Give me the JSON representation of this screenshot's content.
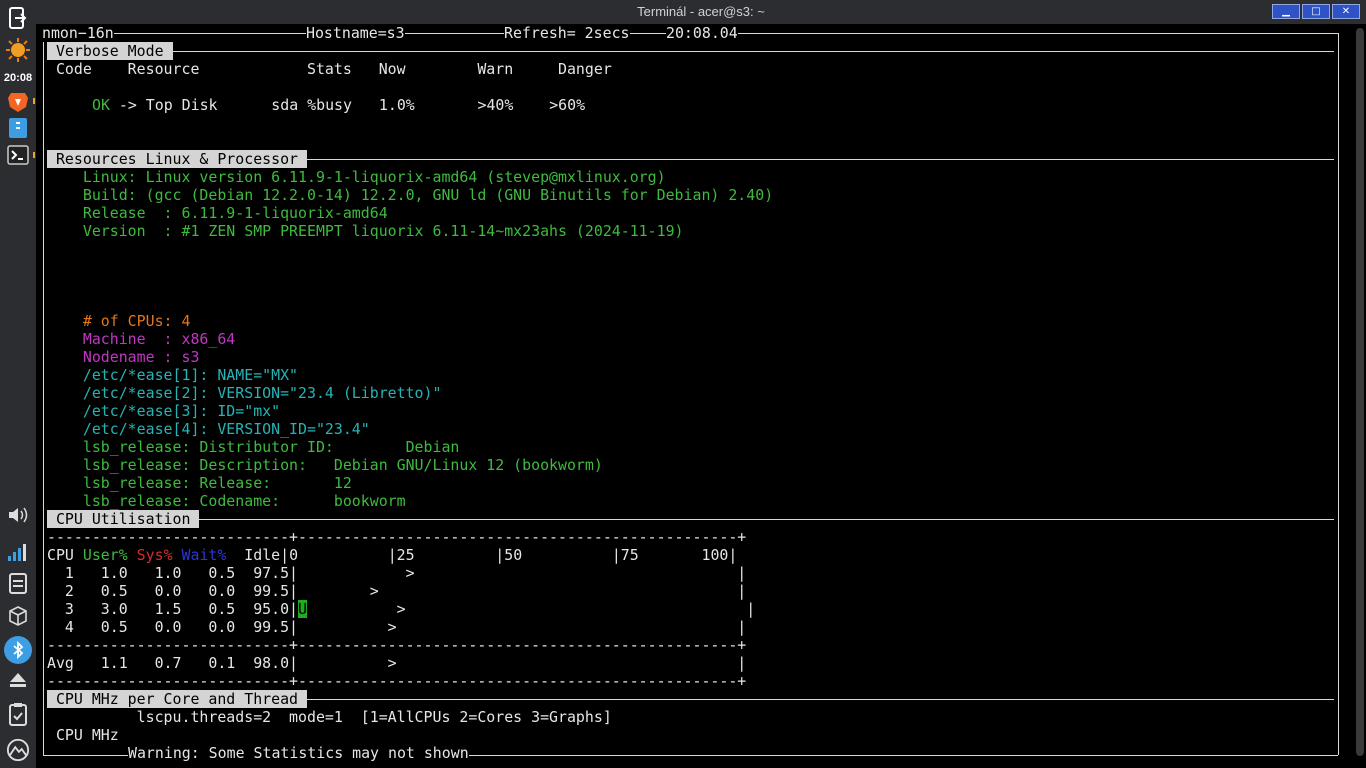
{
  "window": {
    "title": "Terminál - acer@s3: ~",
    "min": "▁",
    "max": "□",
    "close": "✕"
  },
  "taskbar": {
    "clock": "20:08"
  },
  "nmon": {
    "top_left": "nmon−16n",
    "hostname": "Hostname=s3",
    "refresh": "Refresh= 2secs",
    "time": "20:08.04"
  },
  "verbose": {
    "header": " Verbose Mode ",
    "columns": " Code    Resource            Stats   Now        Warn     Danger",
    "row_ok": "OK",
    "row_rest": " -> Top Disk      sda %busy   1.0%       >40%    >60%"
  },
  "resources": {
    "header": " Resources Linux & Processor ",
    "linux": "    Linux: Linux version 6.11.9-1-liquorix-amd64 (stevep@mxlinux.org)",
    "build": "    Build: (gcc (Debian 12.2.0-14) 12.2.0, GNU ld (GNU Binutils for Debian) 2.40)",
    "release": "    Release  : 6.11.9-1-liquorix-amd64",
    "version": "    Version  : #1 ZEN SMP PREEMPT liquorix 6.11-14~mx23ahs (2024-11-19)",
    "cpus": "    # of CPUs: 4",
    "machine": "    Machine  : x86_64",
    "nodename": "    Nodename : s3",
    "ease1": "    /etc/*ease[1]: NAME=\"MX\"",
    "ease2": "    /etc/*ease[2]: VERSION=\"23.4 (Libretto)\"",
    "ease3": "    /etc/*ease[3]: ID=\"mx\"",
    "ease4": "    /etc/*ease[4]: VERSION_ID=\"23.4\"",
    "lsb1": "    lsb_release: Distributor ID:        Debian",
    "lsb2": "    lsb_release: Description:   Debian GNU/Linux 12 (bookworm)",
    "lsb3": "    lsb_release: Release:       12",
    "lsb4": "    lsb_release: Codename:      bookworm"
  },
  "cpu": {
    "header": " CPU Utilisation ",
    "border_top": "---------------------------+-------------------------------------------------+",
    "hdr_cpu": "CPU ",
    "hdr_user": "User%",
    "hdr_sys": "Sys%",
    "hdr_wait": "Wait%",
    "hdr_rest": "  Idle|0          |25         |50          |75       100|",
    "rows": [
      "  1   1.0   1.0   0.5  97.5|            >                                    |",
      "  2   0.5   0.0   0.0  99.5|        >                                        |",
      "  3   3.0   1.5   0.5  95.0|",
      "  4   0.5   0.0   0.0  99.5|          >                                      |"
    ],
    "row3_cursor": "U",
    "row3_tail": "          >                                      |",
    "border_mid": "---------------------------+-------------------------------------------------+",
    "avg": "Avg   1.1   0.7   0.1  98.0|          >                                      |",
    "border_bot": "---------------------------+-------------------------------------------------+"
  },
  "mhz": {
    "header": " CPU MHz per Core and Thread ",
    "lscpu": "          lscpu.threads=2  mode=1  [1=AllCPUs 2=Cores 3=Graphs]",
    "label": " CPU MHz",
    "warning": "Warning: Some Statistics may not shown"
  }
}
